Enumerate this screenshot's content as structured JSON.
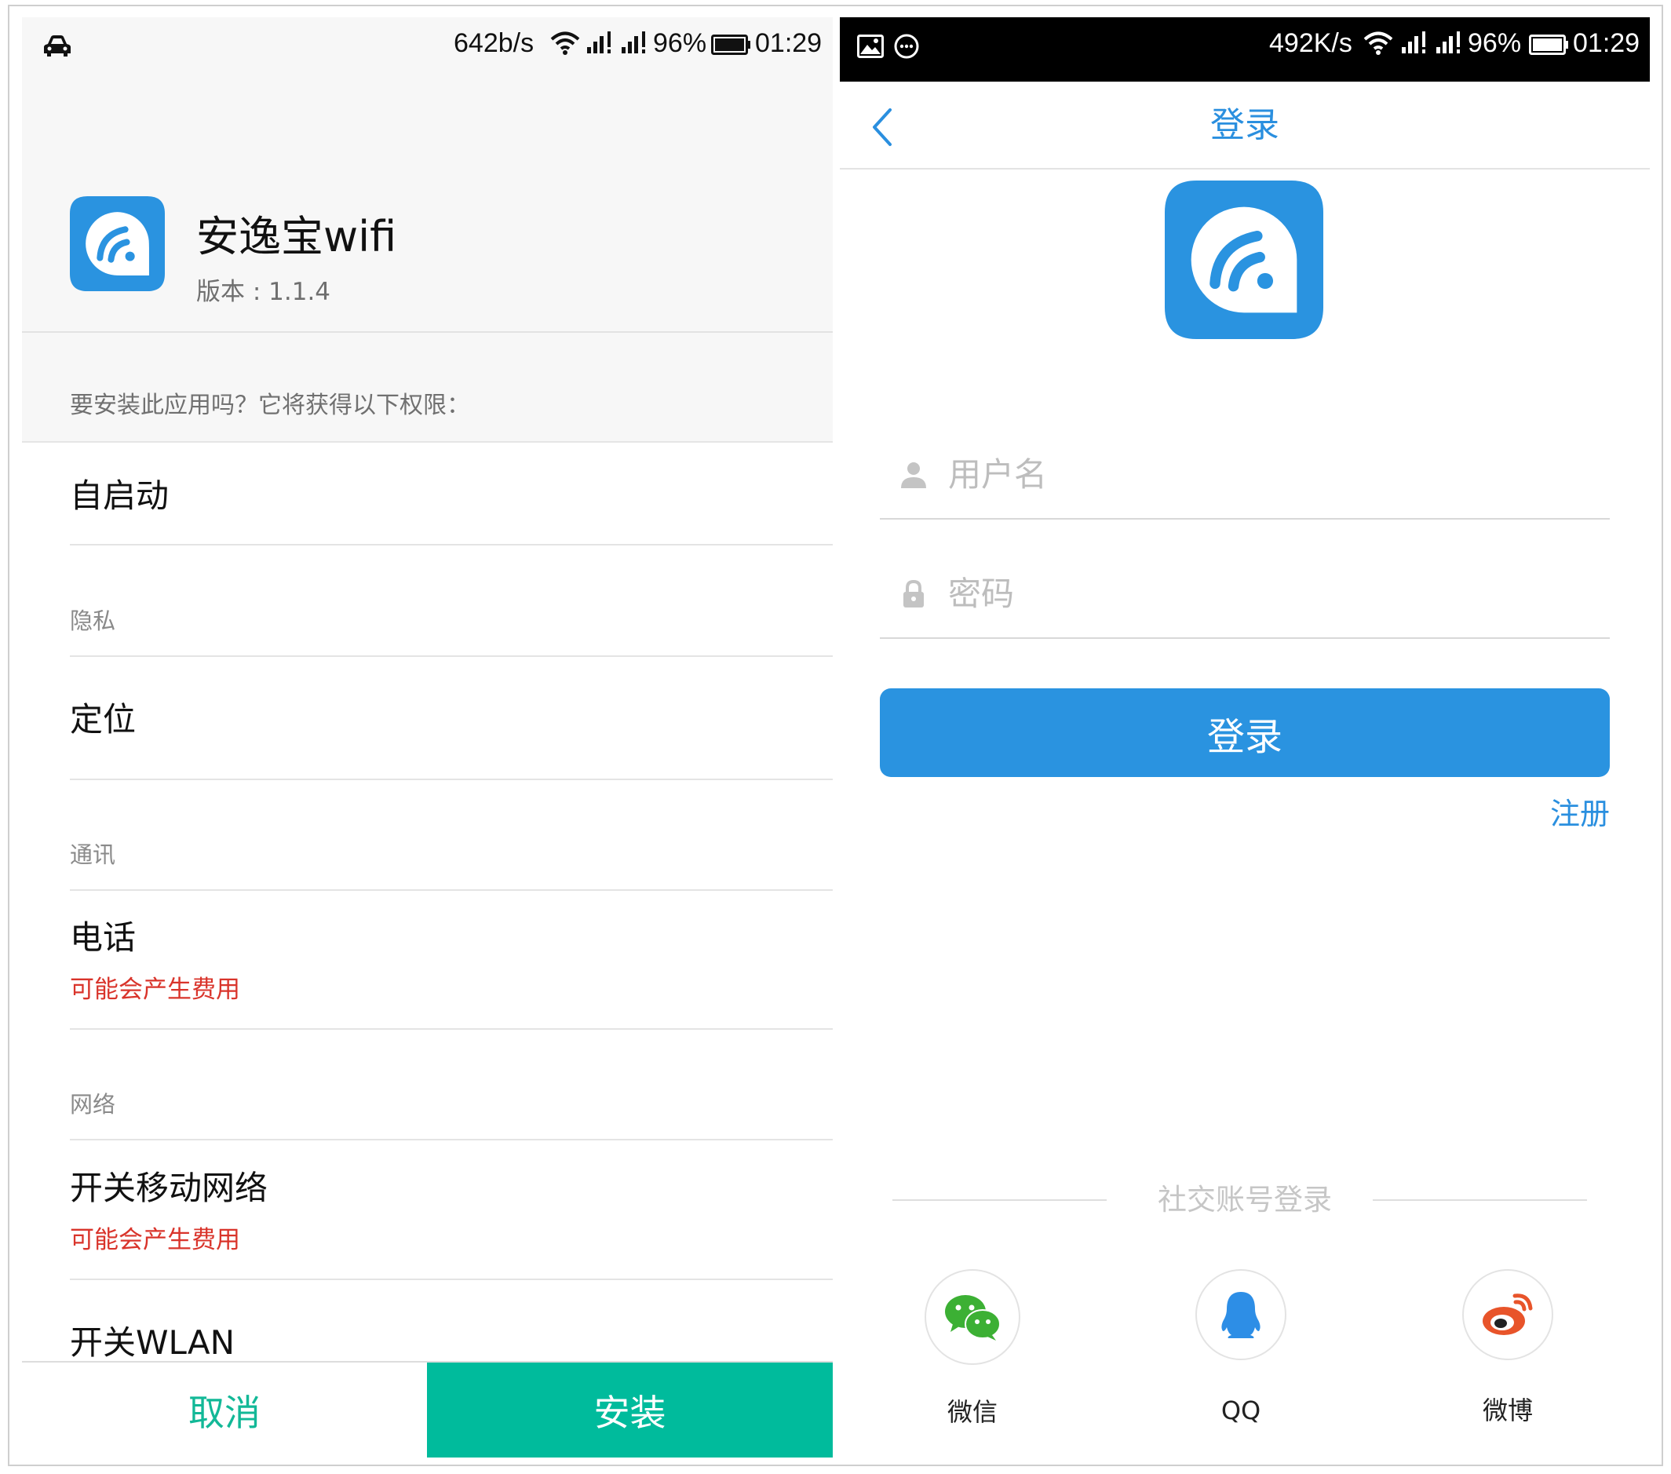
{
  "left_screen": {
    "status_bar": {
      "net_speed": "642b/s",
      "battery": "96%",
      "time": "01:29"
    },
    "app": {
      "name": "安逸宝wifi",
      "version": "版本 : 1.1.4"
    },
    "prompt": "要安装此应用吗？它将获得以下权限：",
    "permissions": {
      "autostart": "自启动",
      "privacy_category": "隐私",
      "location": "定位",
      "comm_category": "通讯",
      "phone": "电话",
      "phone_warning": "可能会产生费用",
      "network_category": "网络",
      "mobile_data": "开关移动网络",
      "mobile_data_warning": "可能会产生费用",
      "wlan": "开关WLAN"
    },
    "buttons": {
      "cancel": "取消",
      "install": "安装"
    }
  },
  "right_screen": {
    "status_bar": {
      "net_speed": "492K/s",
      "battery": "96%",
      "time": "01:29"
    },
    "nav": {
      "title": "登录"
    },
    "form": {
      "username_placeholder": "用户名",
      "password_placeholder": "密码",
      "login_button": "登录",
      "register_link": "注册"
    },
    "social": {
      "title": "社交账号登录",
      "wechat": "微信",
      "qq": "QQ",
      "weibo": "微博"
    }
  },
  "colors": {
    "brand_blue": "#2a93e0",
    "install_green": "#00bb9c",
    "warning_red": "#d9342b"
  }
}
